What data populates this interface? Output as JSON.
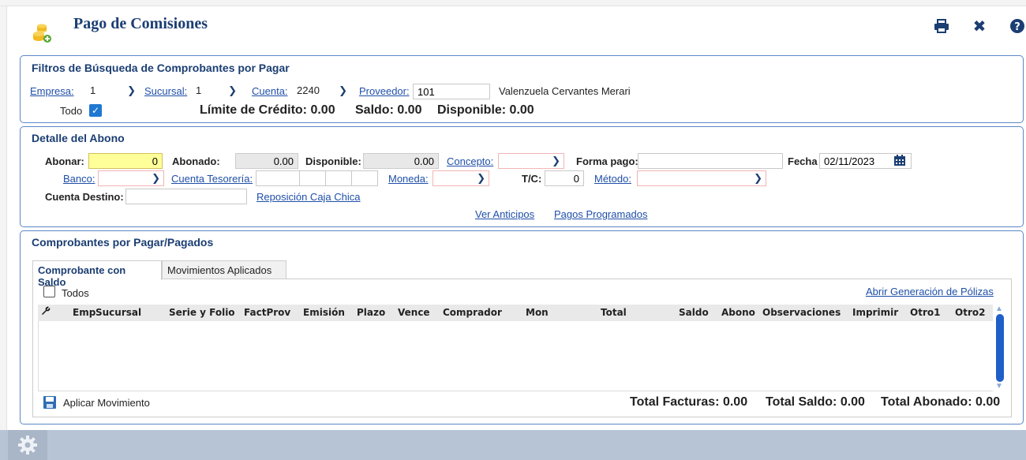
{
  "header": {
    "title": "Pago de Comisiones"
  },
  "filtros": {
    "title": "Filtros de Búsqueda de Comprobantes por Pagar",
    "empresa_label": "Empresa:",
    "empresa_value": "1",
    "sucursal_label": "Sucursal:",
    "sucursal_value": "1",
    "cuenta_label": "Cuenta:",
    "cuenta_value": "2240",
    "proveedor_label": "Proveedor:",
    "proveedor_value": "101",
    "proveedor_nombre": "Valenzuela Cervantes Merari",
    "todo_label": "Todo",
    "limite_credito": "Límite de Crédito: 0.00",
    "saldo": "Saldo: 0.00",
    "disponible": "Disponible: 0.00"
  },
  "detalle": {
    "title": "Detalle del Abono",
    "abonar_label": "Abonar:",
    "abonar_value": "0",
    "abonado_label": "Abonado:",
    "abonado_value": "0.00",
    "disponible_label": "Disponible:",
    "disponible_value": "0.00",
    "concepto_label": "Concepto:",
    "forma_pago_label": "Forma pago:",
    "fecha_label": "Fecha",
    "fecha_value": "02/11/2023",
    "banco_label": "Banco:",
    "cuenta_tesoreria_label": "Cuenta Tesorería:",
    "moneda_label": "Moneda:",
    "tc_label": "T/C:",
    "tc_value": "0",
    "metodo_label": "Método:",
    "cuenta_destino_label": "Cuenta Destino:",
    "reposicion_link": "Reposición Caja Chica",
    "ver_anticipos_link": "Ver Anticipos",
    "pagos_programados_link": "Pagos Programados"
  },
  "comprobantes": {
    "title": "Comprobantes por Pagar/Pagados",
    "tabs": [
      {
        "label": "Comprobante con Saldo"
      },
      {
        "label": "Movimientos Aplicados"
      }
    ],
    "todos_label": "Todos",
    "abrir_polizas_link": "Abrir Generación de Pólizas",
    "columns": [
      "Emp",
      "Sucursal",
      "Serie y Folio",
      "FactProv",
      "Emisión",
      "Plazo",
      "Vence",
      "Comprador",
      "Mon",
      "Total",
      "Saldo",
      "Abono",
      "Observaciones",
      "Imprimir",
      "Otro1",
      "Otro2"
    ],
    "aplicar_label": "Aplicar Movimiento",
    "total_facturas": "Total Facturas: 0.00",
    "total_saldo": "Total Saldo: 0.00",
    "total_abonado": "Total Abonado: 0.00"
  },
  "colors": {
    "accent": "#1b3e73",
    "link": "#1f4fa8",
    "panel_border": "#5b87c5",
    "input_highlight": "#ffff99"
  }
}
